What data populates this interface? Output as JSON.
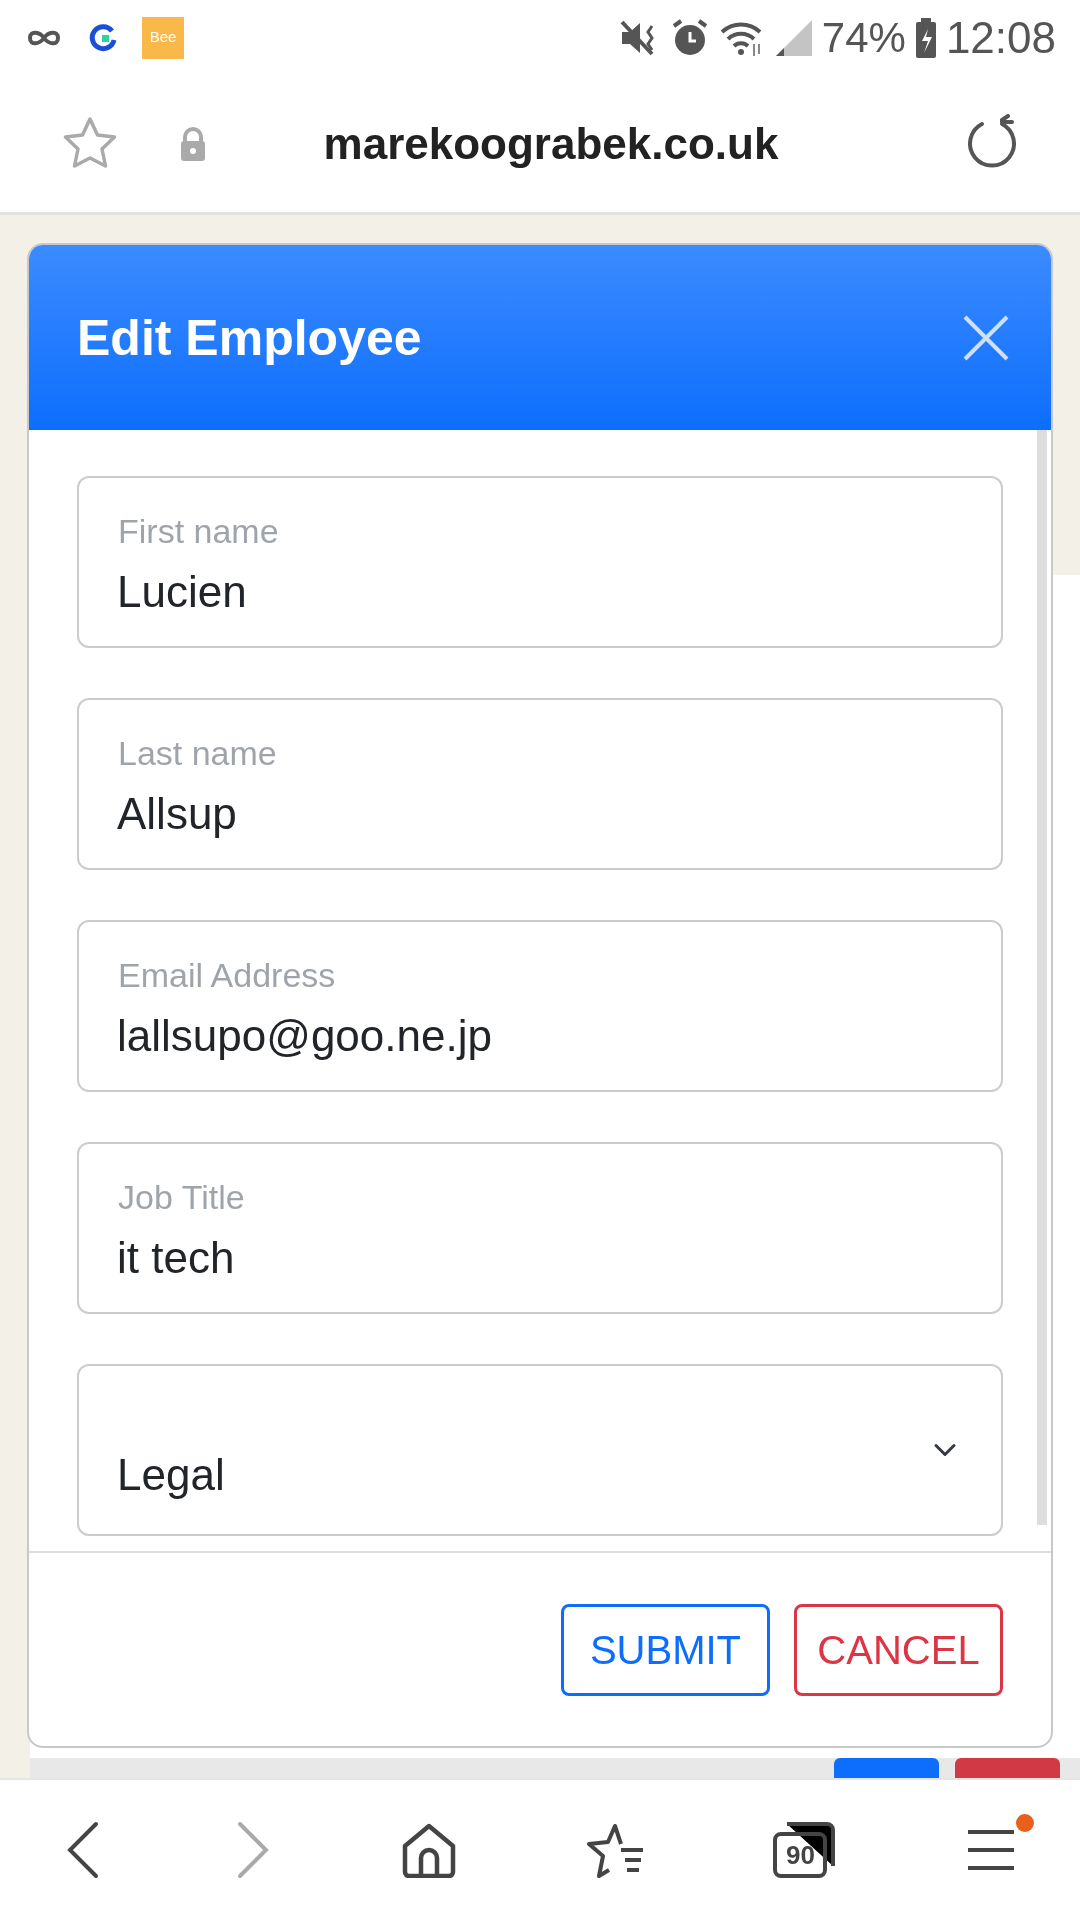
{
  "status_bar": {
    "app_badge": "Bee",
    "battery": "74%",
    "time": "12:08"
  },
  "browser": {
    "url": "marekoograbek.co.uk",
    "tab_count": "90",
    "menu_notification": true
  },
  "modal": {
    "title": "Edit Employee",
    "fields": [
      {
        "kind": "text",
        "label": "First name",
        "value": "Lucien"
      },
      {
        "kind": "text",
        "label": "Last name",
        "value": "Allsup"
      },
      {
        "kind": "text",
        "label": "Email Address",
        "value": "lallsupo@goo.ne.jp"
      },
      {
        "kind": "text",
        "label": "Job Title",
        "value": "it tech"
      },
      {
        "kind": "select",
        "value": "Legal"
      }
    ],
    "buttons": [
      {
        "label": "SUBMIT",
        "kind": "primary"
      },
      {
        "label": "CANCEL",
        "kind": "danger"
      }
    ]
  }
}
